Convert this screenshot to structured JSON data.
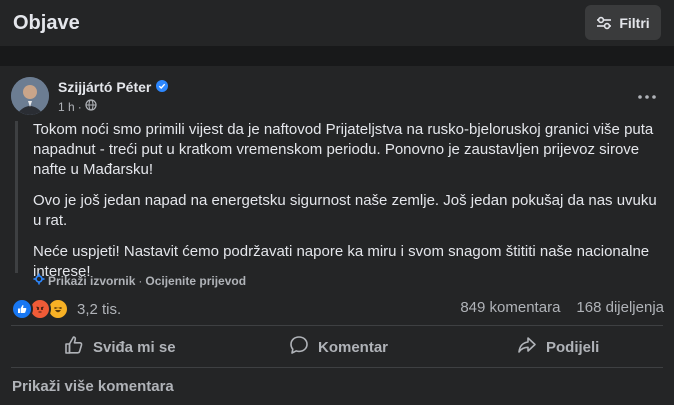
{
  "header": {
    "title": "Objave",
    "filters_label": "Filtri"
  },
  "post": {
    "author": "Szijjártó Péter",
    "time": "1 h",
    "paragraphs": [
      "Tokom noći smo primili vijest da je naftovod Prijateljstva na rusko-bjeloruskoj granici više puta napadnut - treći put u kratkom vremenskom periodu. Ponovno je zaustavljen prijevoz sirove nafte u Mađarsku!",
      "Ovo je još jedan napad na energetsku sigurnost naše zemlje. Još jedan pokušaj da nas uvuku u rat.",
      "Neće uspjeti! Nastavit ćemo podržavati napore ka miru i svom snagom štititi naše nacionalne interese!"
    ],
    "show_source": "Prikaži izvornik",
    "separator": "·",
    "rate_translation": "Ocijenite prijevod",
    "reactions_count": "3,2 tis.",
    "comments_count": "849 komentara",
    "shares_count": "168 dijeljenja"
  },
  "actions": {
    "like": "Sviđa mi se",
    "comment": "Komentar",
    "share": "Podijeli"
  },
  "footer": {
    "more_comments": "Prikaži više komentara"
  },
  "colors": {
    "background": "#18191a",
    "card": "#242526",
    "verified": "#2d88ff",
    "like": "#1877f2",
    "angry": "#f05b37",
    "haha": "#f7b125"
  }
}
